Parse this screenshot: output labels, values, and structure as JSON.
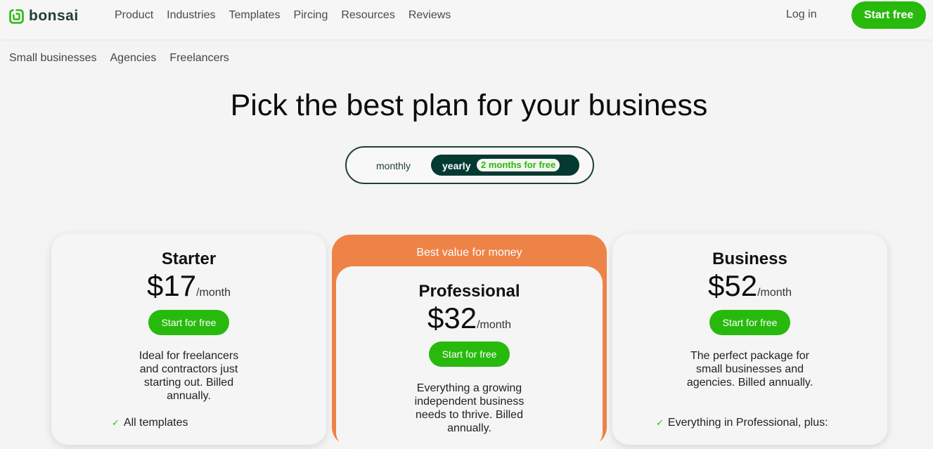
{
  "brand": {
    "name": "bonsai",
    "color": "#1f3d33",
    "accent": "#28b90d"
  },
  "nav": {
    "links": [
      "Product",
      "Industries",
      "Templates",
      "Pircing",
      "Resources",
      "Reviews"
    ],
    "login": "Log in",
    "start_free": "Start free"
  },
  "subnav": [
    "Small businesses",
    "Agencies",
    "Freelancers"
  ],
  "headline": "Pick the best plan for your business",
  "toggle": {
    "monthly": "monthly",
    "yearly": "yearly",
    "badge": "2 months for free",
    "selected": "yearly"
  },
  "plans": {
    "starter": {
      "name": "Starter",
      "price": "$17",
      "unit": "/month",
      "cta": "Start for free",
      "description": "Ideal for freelancers and contractors just starting out. Billed annually.",
      "features": [
        "All templates"
      ]
    },
    "professional": {
      "banner": "Best value for money",
      "name": "Professional",
      "price": "$32",
      "unit": "/month",
      "cta": "Start for free",
      "description": "Everything a growing independent business needs to thrive. Billed annually."
    },
    "business": {
      "name": "Business",
      "price": "$52",
      "unit": "/month",
      "cta": "Start for free",
      "description": "The perfect package for small businesses and agencies. Billed annually.",
      "features": [
        "Everything in Professional, plus:"
      ]
    }
  },
  "colors": {
    "highlight": "#ee8347",
    "toggle_dark": "#043a31"
  }
}
